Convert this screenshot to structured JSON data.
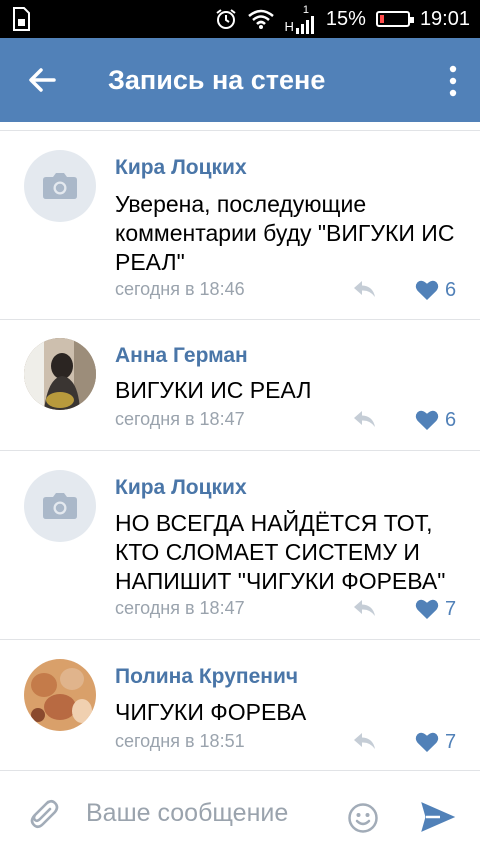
{
  "statusbar": {
    "network": "H",
    "sim": "1",
    "battery": "15%",
    "battery_fraction": 0.15,
    "time": "19:01"
  },
  "header": {
    "title": "Запись на стене",
    "back_icon": "arrow-left-icon",
    "menu_icon": "more-vertical-icon"
  },
  "comments": [
    {
      "author": "Кира Лоцких",
      "text": "Уверена, последующие комментарии буду \"ВИГУКИ ИС РЕАЛ\"",
      "time": "сегодня в 18:46",
      "likes": "6",
      "avatar": "camera-placeholder"
    },
    {
      "author": "Анна Герман",
      "text": "ВИГУКИ ИС РЕАЛ",
      "time": "сегодня в 18:47",
      "likes": "6",
      "avatar": "photo"
    },
    {
      "author": "Кира Лоцких",
      "text": "НО ВСЕГДА НАЙДЁТСЯ ТОТ, КТО СЛОМАЕТ СИСТЕМУ И НАПИШИТ \"ЧИГУКИ ФОРЕВА\"",
      "time": "сегодня в 18:47",
      "likes": "7",
      "avatar": "camera-placeholder"
    },
    {
      "author": "Полина Крупенич",
      "text": "ЧИГУКИ ФОРЕВА",
      "time": "сегодня в 18:51",
      "likes": "7",
      "avatar": "photo"
    }
  ],
  "composer": {
    "placeholder": "Ваше сообщение",
    "attach_icon": "paperclip-icon",
    "emoji_icon": "smile-icon",
    "send_icon": "send-icon"
  },
  "colors": {
    "header": "#5181b8",
    "author": "#4a76a8",
    "like": "#5181b8",
    "meta": "#9aa3ad"
  }
}
